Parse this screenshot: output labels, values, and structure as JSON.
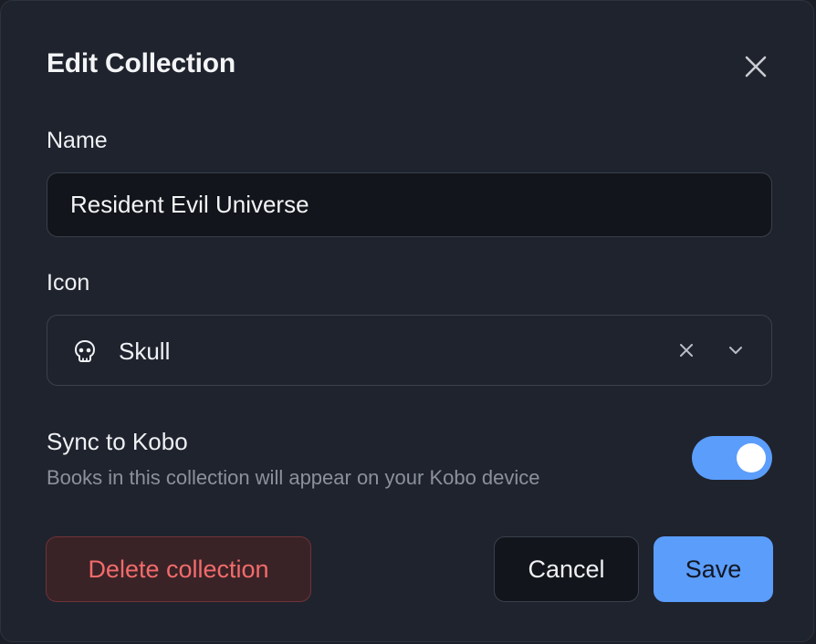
{
  "dialog": {
    "title": "Edit Collection",
    "close_icon": "close-icon"
  },
  "name_field": {
    "label": "Name",
    "value": "Resident Evil Universe"
  },
  "icon_field": {
    "label": "Icon",
    "selected_icon": "skull-icon",
    "selected_value": "Skull",
    "clear_icon": "clear-icon",
    "dropdown_icon": "chevron-down-icon"
  },
  "sync": {
    "title": "Sync to Kobo",
    "description": "Books in this collection will appear on your Kobo device",
    "enabled": true
  },
  "actions": {
    "delete_label": "Delete collection",
    "cancel_label": "Cancel",
    "save_label": "Save"
  },
  "colors": {
    "accent": "#5b9dfb",
    "danger": "#f26b6b",
    "background": "#1f232d"
  }
}
